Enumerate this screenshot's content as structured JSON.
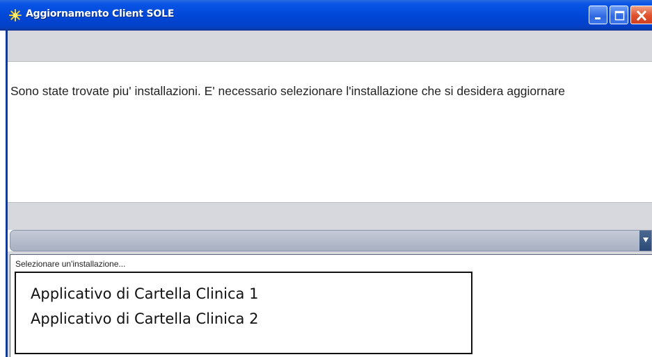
{
  "window": {
    "title": "Aggiornamento Client SOLE",
    "icon": "sun-icon",
    "controls": {
      "minimize": "minimize-icon",
      "maximize": "maximize-icon",
      "close": "close-icon"
    }
  },
  "message": "Sono state trovate piu' installazioni. E' necessario selezionare l'installazione che si desidera aggiornare",
  "combo": {
    "selected": "",
    "arrow_icon": "chevron-down-icon"
  },
  "dropdown": {
    "hint": "Selezionare un'installazione...",
    "options": [
      "Applicativo di Cartella Clinica 1",
      "Applicativo di Cartella Clinica 2"
    ]
  },
  "colors": {
    "titlebar": "#0048d8",
    "close_button": "#e0502c",
    "panel": "#d6d8de"
  }
}
